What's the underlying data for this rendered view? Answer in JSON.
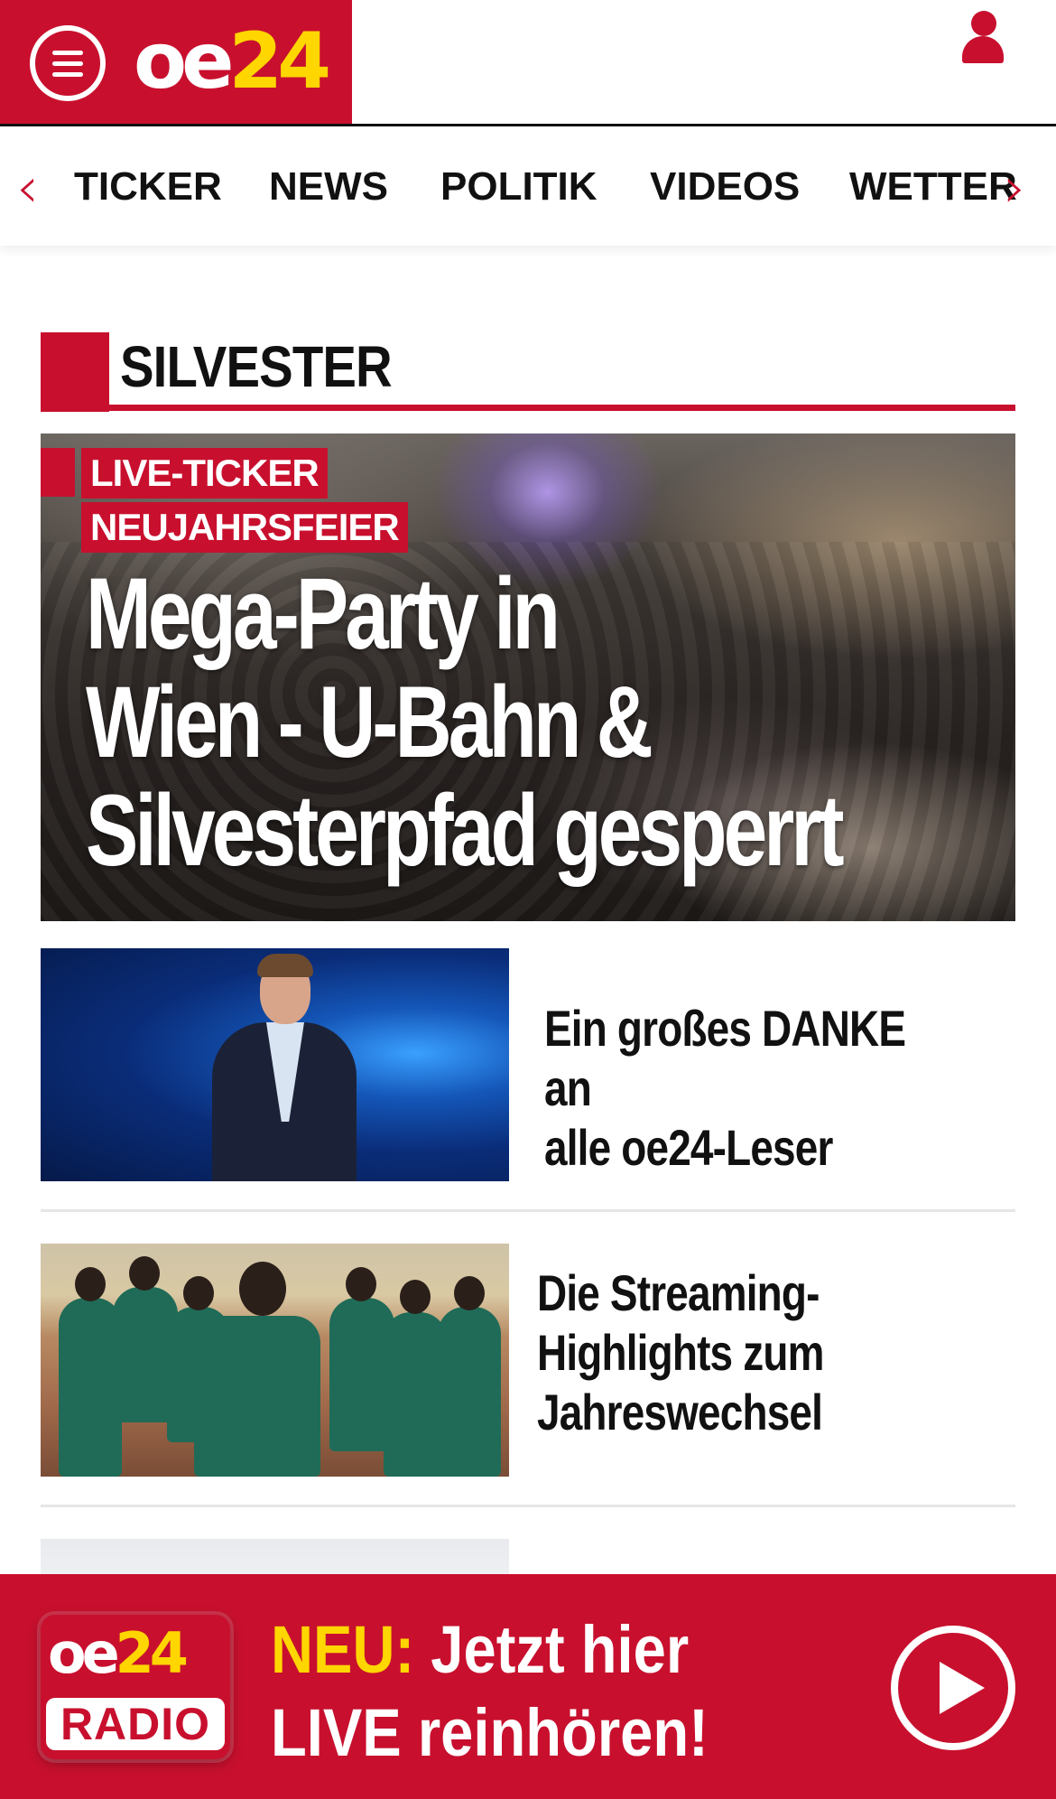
{
  "header": {
    "logo_part1": "oe",
    "logo_part2": "24",
    "menu_icon": "hamburger-menu-icon",
    "user_icon": "user-icon",
    "brand_color": "#c8102e",
    "logo_accent": "#ffd600"
  },
  "nav": {
    "items": [
      {
        "label": "TICKER"
      },
      {
        "label": "NEWS"
      },
      {
        "label": "POLITIK"
      },
      {
        "label": "VIDEOS"
      },
      {
        "label": "WETTER"
      }
    ],
    "prev_arrow": "‹",
    "next_arrow": "›"
  },
  "section": {
    "title": "SILVESTER"
  },
  "hero": {
    "badge1": "LIVE-TICKER",
    "badge2": "NEUJAHRSFEIER",
    "headline_line1": "Mega-Party in",
    "headline_line2": "Wien - U-Bahn &",
    "headline_line3": "Silvesterpfad gesperrt"
  },
  "articles": [
    {
      "line1": "Ein großes DANKE an",
      "line2": "alle oe24-Leser"
    },
    {
      "line1": "Die Streaming-",
      "line2": "Highlights zum",
      "line3": "Jahreswechsel"
    }
  ],
  "radio": {
    "logo_top_part1": "oe",
    "logo_top_part2": "24",
    "logo_bottom": "RADIO",
    "highlight": "NEU:",
    "line1_rest": " Jetzt hier",
    "line2": "LIVE reinhören!",
    "play_icon": "play-icon"
  }
}
